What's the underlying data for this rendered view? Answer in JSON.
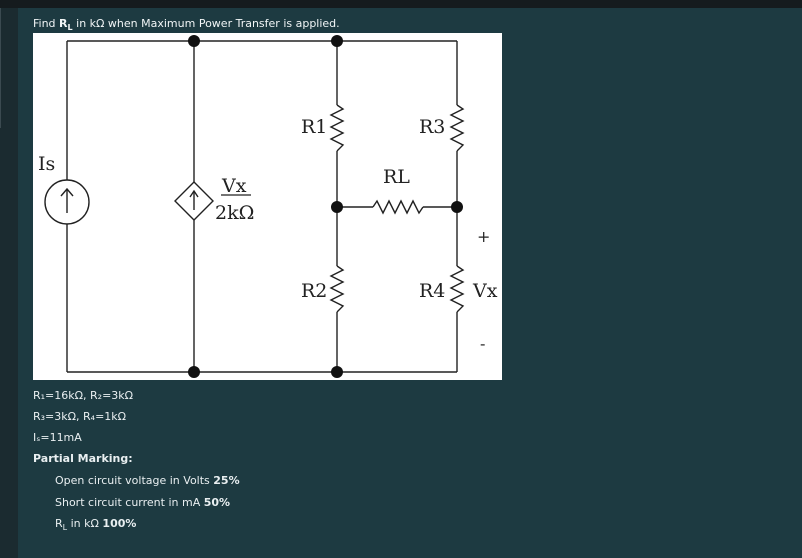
{
  "question": {
    "prefix": "Find ",
    "var_main": "R",
    "var_sub": "L",
    "suffix": " in kΩ when Maximum Power Transfer is applied."
  },
  "circuit": {
    "labels": {
      "is": "Is",
      "r1": "R1",
      "r2": "R2",
      "r3": "R3",
      "r4": "R4",
      "rl": "RL",
      "vx": "Vx",
      "dep_num": "Vx",
      "dep_den": "2kΩ",
      "plus": "+",
      "minus": "-"
    }
  },
  "given": {
    "line1": "R₁=16kΩ, R₂=3kΩ",
    "line2": "R₃=3kΩ, R₄=1kΩ",
    "line3": "Iₛ=11mA"
  },
  "partial_marking": {
    "title": "Partial Marking:",
    "items": [
      {
        "text": "Open circuit voltage in Volts ",
        "weight": "25%"
      },
      {
        "text": "Short circuit current in mA ",
        "weight": "50%"
      },
      {
        "text": " in kΩ ",
        "var_main": "R",
        "var_sub": "L",
        "weight": "100%"
      }
    ]
  }
}
